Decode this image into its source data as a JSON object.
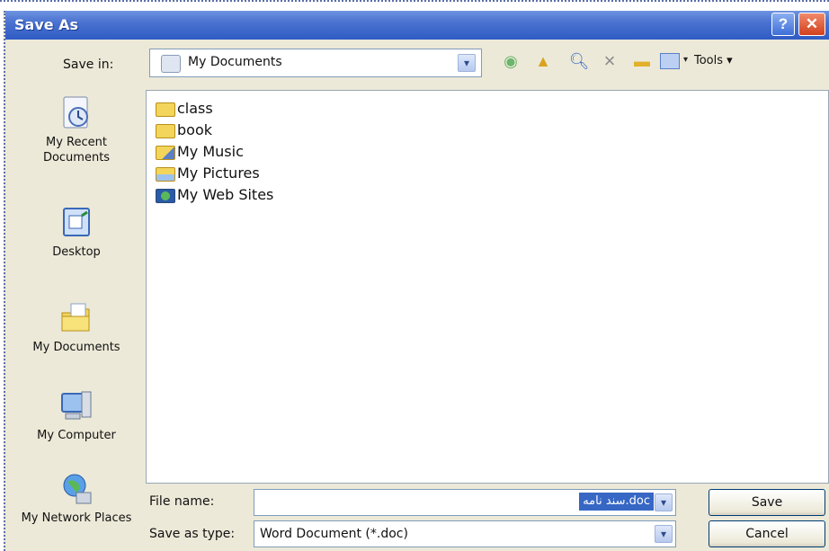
{
  "window": {
    "title": "Save As"
  },
  "titlebar": {
    "help_label": "?",
    "close_label": "✕"
  },
  "toolbar": {
    "save_in_label": "Save in:",
    "save_in_value": "My Documents",
    "tools_label": "Tools ▾",
    "views_arrow": "▾"
  },
  "places": [
    {
      "label": "My Recent Documents",
      "icon": "recent-documents-icon"
    },
    {
      "label": "Desktop",
      "icon": "desktop-icon"
    },
    {
      "label": "My Documents",
      "icon": "my-documents-icon"
    },
    {
      "label": "My Computer",
      "icon": "my-computer-icon"
    },
    {
      "label": "My Network Places",
      "icon": "network-places-icon"
    }
  ],
  "files": [
    {
      "name": "class",
      "icon": "folder-icon"
    },
    {
      "name": "book",
      "icon": "folder-icon"
    },
    {
      "name": "My Music",
      "icon": "music-folder-icon"
    },
    {
      "name": "My Pictures",
      "icon": "pictures-folder-icon"
    },
    {
      "name": "My Web Sites",
      "icon": "web-sites-icon"
    }
  ],
  "bottom": {
    "file_name_label": "File name:",
    "file_name_value": "سند نامه.doc",
    "save_as_type_label": "Save as type:",
    "save_as_type_value": "Word Document (*.doc)",
    "save_button": "Save",
    "cancel_button": "Cancel"
  },
  "colors": {
    "titlebar": "#2f5cc4",
    "dialog_bg": "#ece9d8",
    "selection": "#3667c4"
  }
}
